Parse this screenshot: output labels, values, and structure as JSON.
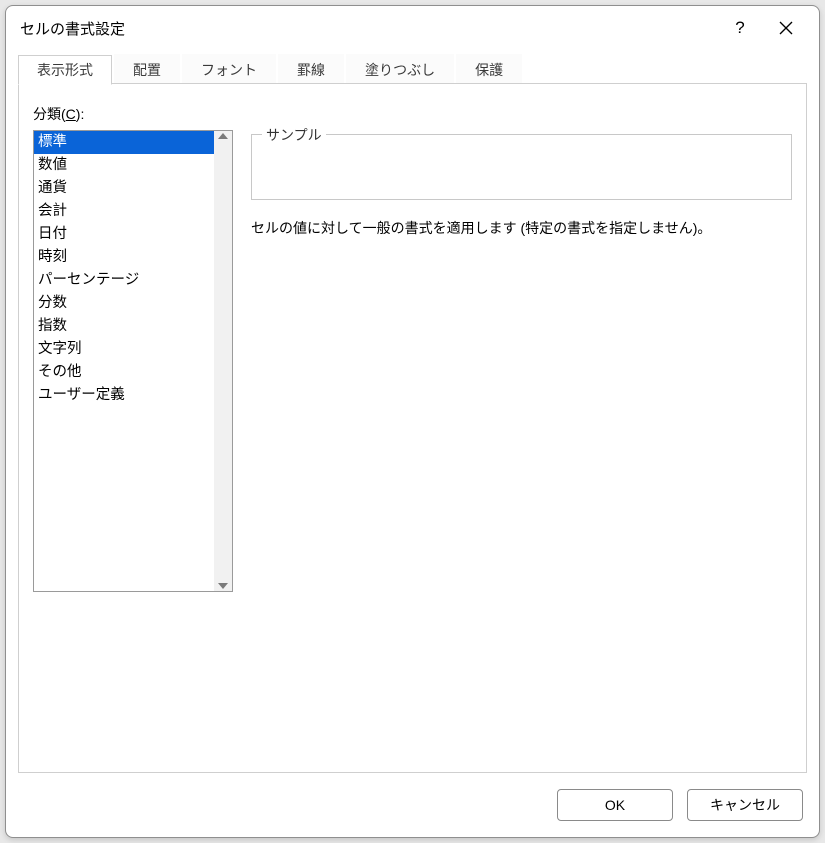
{
  "dialog": {
    "title": "セルの書式設定",
    "help": "?",
    "close": "×"
  },
  "tabs": [
    {
      "label": "表示形式",
      "active": true
    },
    {
      "label": "配置",
      "active": false
    },
    {
      "label": "フォント",
      "active": false
    },
    {
      "label": "罫線",
      "active": false
    },
    {
      "label": "塗りつぶし",
      "active": false
    },
    {
      "label": "保護",
      "active": false
    }
  ],
  "category": {
    "label_prefix": "分類(",
    "label_key": "C",
    "label_suffix": "):",
    "items": [
      {
        "label": "標準",
        "selected": true
      },
      {
        "label": "数値"
      },
      {
        "label": "通貨"
      },
      {
        "label": "会計"
      },
      {
        "label": "日付"
      },
      {
        "label": "時刻"
      },
      {
        "label": "パーセンテージ"
      },
      {
        "label": "分数"
      },
      {
        "label": "指数"
      },
      {
        "label": "文字列"
      },
      {
        "label": "その他"
      },
      {
        "label": "ユーザー定義"
      }
    ]
  },
  "sample": {
    "legend": "サンプル",
    "value": ""
  },
  "description": "セルの値に対して一般の書式を適用します (特定の書式を指定しません)。",
  "buttons": {
    "ok": "OK",
    "cancel": "キャンセル"
  }
}
